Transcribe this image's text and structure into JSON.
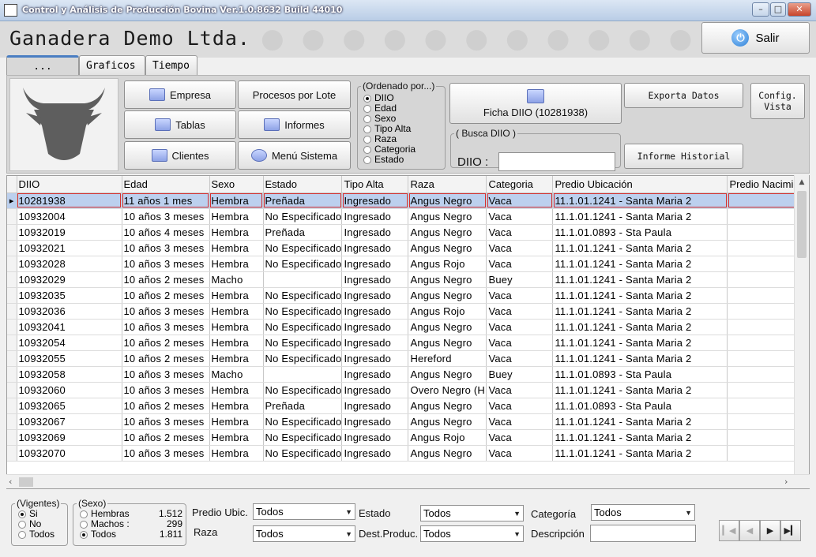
{
  "window": {
    "title": "Control y Análisis de Producción Bovina  Ver.1.0.8632 Build 44010"
  },
  "header": {
    "company": "Ganadera Demo Ltda.",
    "exit_label": "Salir"
  },
  "tabs": [
    {
      "label": "..."
    },
    {
      "label": "Graficos"
    },
    {
      "label": "Tiempo"
    }
  ],
  "toolbar": {
    "empresa": "Empresa",
    "tablas": "Tablas",
    "clientes": "Clientes",
    "procesos": "Procesos por Lote",
    "informes": "Informes",
    "menu": "Menú Sistema",
    "ficha": "Ficha DIIO (10281938)",
    "exporta": "Exporta Datos",
    "config1": "Config.",
    "config2": "Vista",
    "historial": "Informe Historial"
  },
  "order": {
    "legend": "(Ordenado por...)",
    "options": [
      "DIIO",
      "Edad",
      "Sexo",
      "Tipo Alta",
      "Raza",
      "Categoria",
      "Estado"
    ],
    "selected": "DIIO"
  },
  "search": {
    "legend": "( Busca DIIO )",
    "label": "DIIO :",
    "value": ""
  },
  "table": {
    "columns": [
      "DIIO",
      "Edad",
      "Sexo",
      "Estado",
      "Tipo Alta",
      "Raza",
      "Categoria",
      "Predio Ubicación",
      "Predio Nacimie"
    ],
    "rows": [
      [
        "10281938",
        "11 años 1 mes",
        "Hembra",
        "Preñada",
        "Ingresado",
        "Angus Negro",
        "Vaca",
        "11.1.01.1241 - Santa Maria 2",
        ""
      ],
      [
        "10932004",
        "10 años 3 meses",
        "Hembra",
        "No Especificado",
        "Ingresado",
        "Angus Negro",
        "Vaca",
        "11.1.01.1241 - Santa Maria 2",
        ""
      ],
      [
        "10932019",
        "10 años 4 meses",
        "Hembra",
        "Preñada",
        "Ingresado",
        "Angus Negro",
        "Vaca",
        "11.1.01.0893 - Sta Paula",
        ""
      ],
      [
        "10932021",
        "10 años 3 meses",
        "Hembra",
        "No Especificado",
        "Ingresado",
        "Angus Negro",
        "Vaca",
        "11.1.01.1241 - Santa Maria 2",
        ""
      ],
      [
        "10932028",
        "10 años 3 meses",
        "Hembra",
        "No Especificado",
        "Ingresado",
        "Angus Rojo",
        "Vaca",
        "11.1.01.1241 - Santa Maria 2",
        ""
      ],
      [
        "10932029",
        "10 años 2 meses",
        "Macho",
        "",
        "Ingresado",
        "Angus Negro",
        "Buey",
        "11.1.01.1241 - Santa Maria 2",
        ""
      ],
      [
        "10932035",
        "10 años 2 meses",
        "Hembra",
        "No Especificado",
        "Ingresado",
        "Angus Negro",
        "Vaca",
        "11.1.01.1241 - Santa Maria 2",
        ""
      ],
      [
        "10932036",
        "10 años 3 meses",
        "Hembra",
        "No Especificado",
        "Ingresado",
        "Angus Rojo",
        "Vaca",
        "11.1.01.1241 - Santa Maria 2",
        ""
      ],
      [
        "10932041",
        "10 años 3 meses",
        "Hembra",
        "No Especificado",
        "Ingresado",
        "Angus Negro",
        "Vaca",
        "11.1.01.1241 - Santa Maria 2",
        ""
      ],
      [
        "10932054",
        "10 años 2 meses",
        "Hembra",
        "No Especificado",
        "Ingresado",
        "Angus Negro",
        "Vaca",
        "11.1.01.1241 - Santa Maria 2",
        ""
      ],
      [
        "10932055",
        "10 años 2 meses",
        "Hembra",
        "No Especificado",
        "Ingresado",
        "Hereford",
        "Vaca",
        "11.1.01.1241 - Santa Maria 2",
        ""
      ],
      [
        "10932058",
        "10 años 3 meses",
        "Macho",
        "",
        "Ingresado",
        "Angus Negro",
        "Buey",
        "11.1.01.0893 - Sta Paula",
        ""
      ],
      [
        "10932060",
        "10 años 3 meses",
        "Hembra",
        "No Especificado",
        "Ingresado",
        "Overo Negro (H",
        "Vaca",
        "11.1.01.1241 - Santa Maria 2",
        ""
      ],
      [
        "10932065",
        "10 años 2 meses",
        "Hembra",
        "Preñada",
        "Ingresado",
        "Angus Negro",
        "Vaca",
        "11.1.01.0893 - Sta Paula",
        ""
      ],
      [
        "10932067",
        "10 años 3 meses",
        "Hembra",
        "No Especificado",
        "Ingresado",
        "Angus Negro",
        "Vaca",
        "11.1.01.1241 - Santa Maria 2",
        ""
      ],
      [
        "10932069",
        "10 años 2 meses",
        "Hembra",
        "No Especificado",
        "Ingresado",
        "Angus Rojo",
        "Vaca",
        "11.1.01.1241 - Santa Maria 2",
        ""
      ],
      [
        "10932070",
        "10 años 3 meses",
        "Hembra",
        "No Especificado",
        "Ingresado",
        "Angus Negro",
        "Vaca",
        "11.1.01.1241 - Santa Maria 2",
        ""
      ]
    ]
  },
  "vigentes": {
    "legend": "(Vigentes)",
    "options": [
      "Si",
      "No",
      "Todos"
    ],
    "selected": "Si"
  },
  "sexo": {
    "legend": "(Sexo)",
    "options": [
      {
        "label": "Hembras",
        "count": "1.512"
      },
      {
        "label": "Machos  :",
        "count": "299"
      },
      {
        "label": "Todos",
        "count": "1.811"
      }
    ],
    "selected": "Todos"
  },
  "filters": {
    "predio_label": "Predio Ubic.",
    "predio_value": "Todos",
    "raza_label": "Raza",
    "raza_value": "Todos",
    "estado_label": "Estado",
    "estado_value": "Todos",
    "dest_label": "Dest.Produc.",
    "dest_value": "Todos",
    "categoria_label": "Categoría",
    "categoria_value": "Todos",
    "descripcion_label": "Descripción",
    "descripcion_value": ""
  }
}
